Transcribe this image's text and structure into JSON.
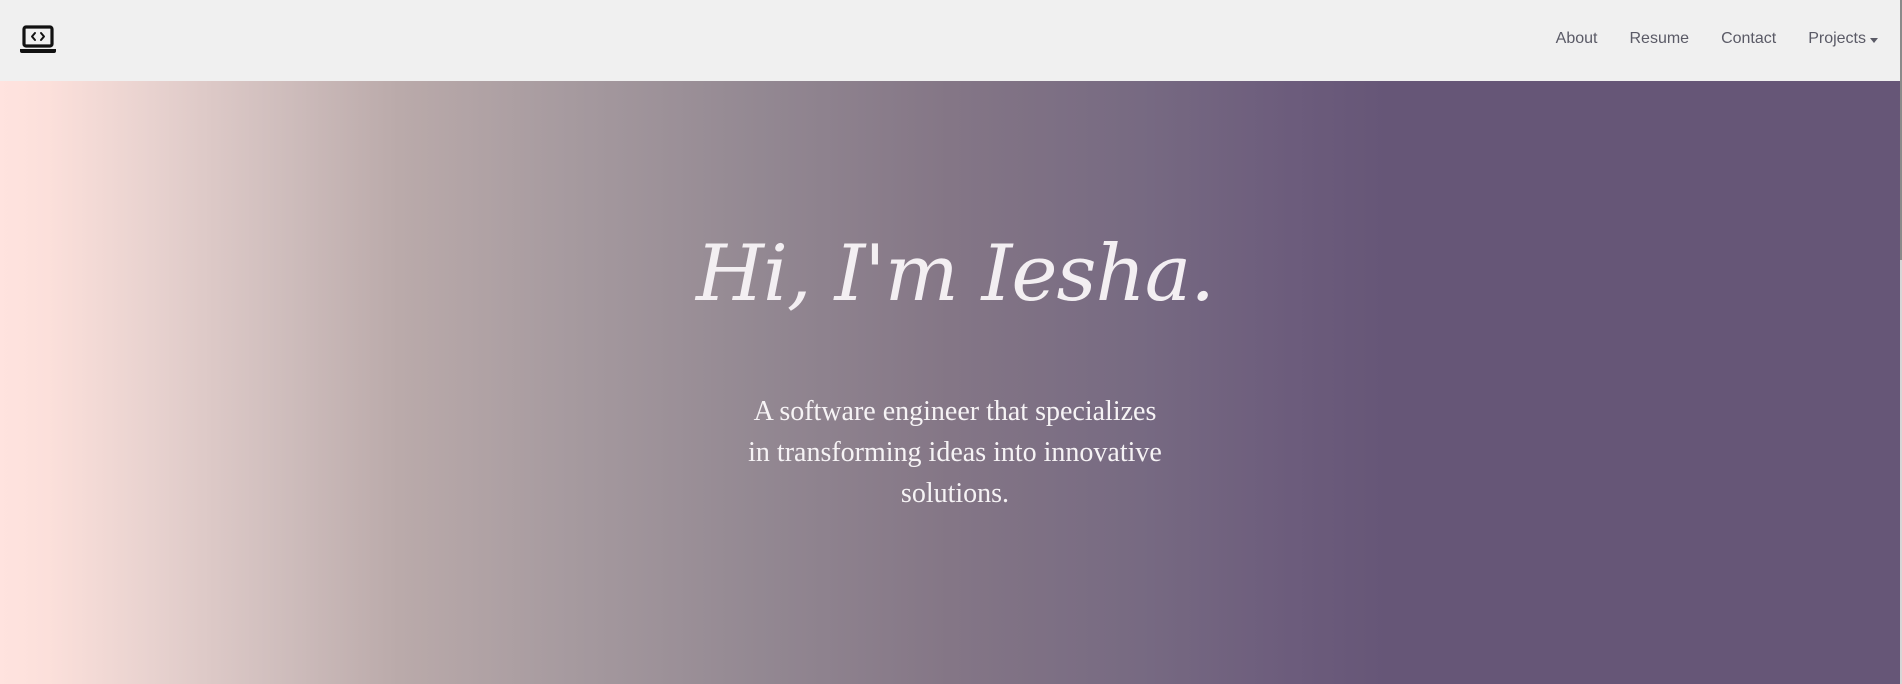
{
  "navbar": {
    "brand_icon": "laptop-code-icon",
    "links": [
      {
        "label": "About"
      },
      {
        "label": "Resume"
      },
      {
        "label": "Contact"
      },
      {
        "label": "Projects",
        "has_dropdown": true
      }
    ]
  },
  "hero": {
    "title": "Hi, I'm Iesha.",
    "subtitle": "A software engineer that specializes in transforming ideas into innovative solutions.",
    "gradient_start": "#ffe3df",
    "gradient_end": "#665677"
  },
  "colors": {
    "navbar_bg": "#f0f0f0",
    "nav_text": "#5a5a66",
    "hero_text": "#f3eff2"
  }
}
